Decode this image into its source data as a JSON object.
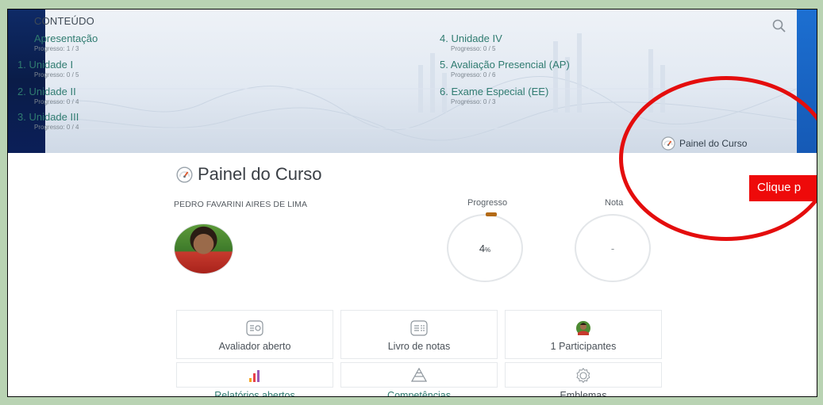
{
  "content_header": {
    "title": "CONTEÚDO"
  },
  "toc": {
    "left": [
      {
        "num": "",
        "label": "Apresentação",
        "progress": "Progresso: 1 / 3"
      },
      {
        "num": "1.",
        "label": "Unidade I",
        "progress": "Progresso: 0 / 5"
      },
      {
        "num": "2.",
        "label": "Unidade II",
        "progress": "Progresso: 0 / 4"
      },
      {
        "num": "3.",
        "label": "Unidade III",
        "progress": "Progresso: 0 / 4"
      }
    ],
    "right": [
      {
        "num": "4.",
        "label": "Unidade IV",
        "progress": "Progresso: 0 / 5"
      },
      {
        "num": "5.",
        "label": "Avaliação Presencial (AP)",
        "progress": "Progresso: 0 / 6"
      },
      {
        "num": "6.",
        "label": "Exame Especial (EE)",
        "progress": "Progresso: 0 / 3"
      }
    ]
  },
  "panel_link": {
    "label": "Painel do Curso",
    "icon": "gauge-icon"
  },
  "page": {
    "title": "Painel do Curso",
    "user_name": "PEDRO FAVARINI AIRES DE LIMA"
  },
  "stats": {
    "progress_label": "Progresso",
    "progress_value": "4",
    "progress_unit": "%",
    "progress_fraction": 0.04,
    "grade_label": "Nota",
    "grade_value": "-"
  },
  "tiles": [
    {
      "label": "Avaliador aberto",
      "icon": "list-check-icon"
    },
    {
      "label": "Livro de notas",
      "icon": "gradebook-icon"
    },
    {
      "label": "1 Participantes",
      "icon": "participant-avatar-icon"
    },
    {
      "label": "Relatórios abertos",
      "icon": "bar-chart-icon"
    },
    {
      "label": "Competências",
      "icon": "pyramid-icon"
    },
    {
      "label": "Emblemas",
      "icon": "badge-icon"
    }
  ],
  "callout": {
    "text": "Clique p"
  },
  "colors": {
    "accent": "#2f7b70",
    "callout_red": "#e40d0d",
    "progress_orange": "#b36a16"
  }
}
